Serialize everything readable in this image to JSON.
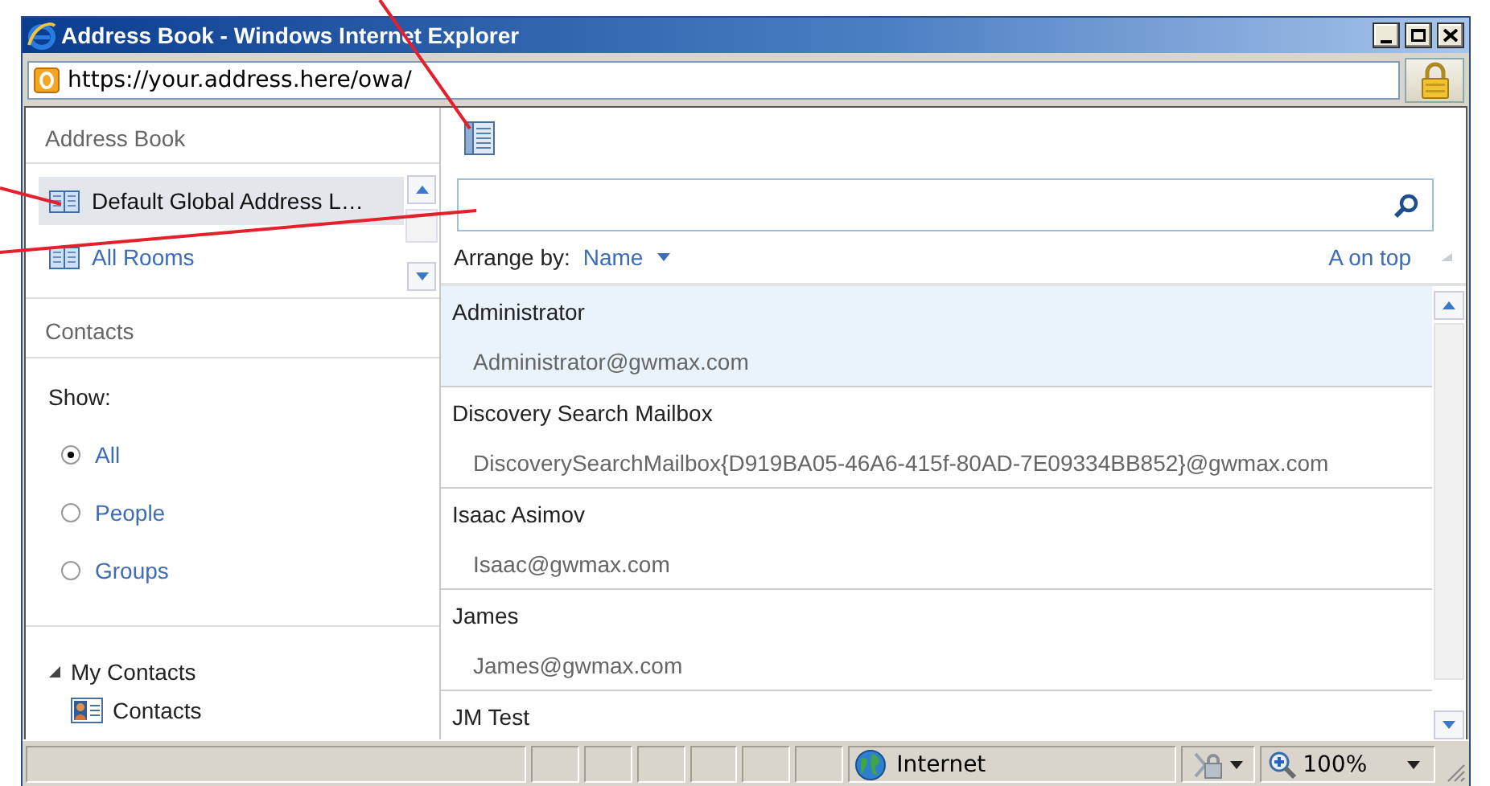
{
  "window": {
    "title": "Address Book - Windows Internet Explorer"
  },
  "address_bar": {
    "url": "https://your.address.here/owa/"
  },
  "sidebar": {
    "header": "Address Book",
    "address_lists": [
      {
        "label": "Default Global Address L…",
        "selected": true
      },
      {
        "label": "All Rooms",
        "selected": false
      }
    ],
    "contacts_header": "Contacts",
    "show_label": "Show:",
    "filters": [
      {
        "label": "All",
        "selected": true
      },
      {
        "label": "People",
        "selected": false
      },
      {
        "label": "Groups",
        "selected": false
      }
    ],
    "tree": [
      {
        "label": "My Contacts",
        "expanded": true,
        "children": [
          {
            "label": "Contacts"
          }
        ]
      }
    ]
  },
  "main": {
    "arrange_label": "Arrange by:",
    "arrange_value": "Name",
    "sort_order": "A on top",
    "contacts": [
      {
        "name": "Administrator",
        "email": "Administrator@gwmax.com",
        "selected": true
      },
      {
        "name": "Discovery Search Mailbox",
        "email": "DiscoverySearchMailbox{D919BA05-46A6-415f-80AD-7E09334BB852}@gwmax.com",
        "selected": false
      },
      {
        "name": "Isaac Asimov",
        "email": "Isaac@gwmax.com",
        "selected": false
      },
      {
        "name": "James",
        "email": "James@gwmax.com",
        "selected": false
      },
      {
        "name": "JM Test",
        "selected": false
      }
    ]
  },
  "status_bar": {
    "zone": "Internet",
    "zoom": "100%"
  }
}
